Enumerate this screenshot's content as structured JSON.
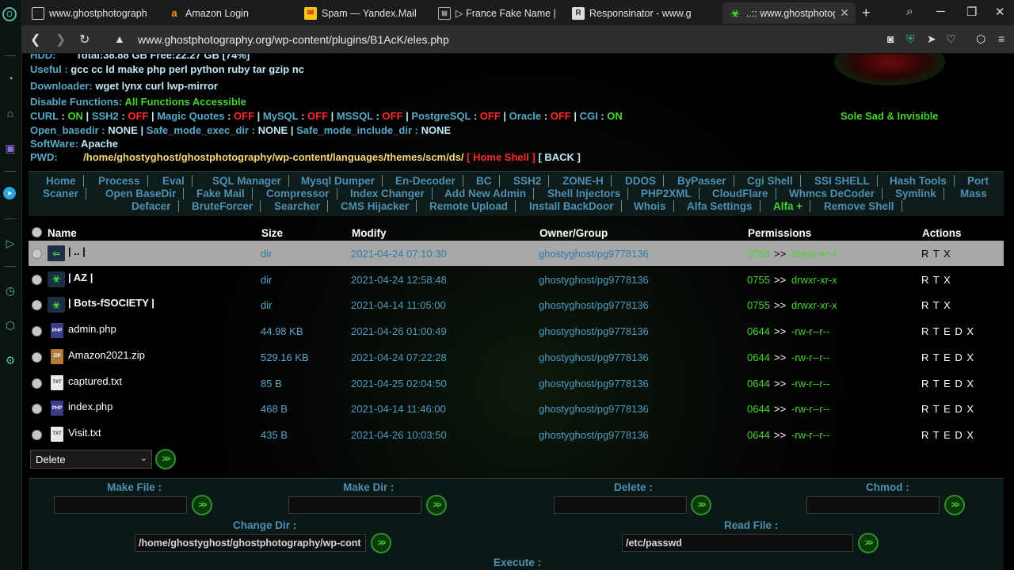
{
  "tabs": [
    {
      "title": "www.ghostphotograph",
      "favicon": "page-icon",
      "active": false
    },
    {
      "title": "Amazon Login",
      "favicon": "amazon-icon",
      "active": false
    },
    {
      "title": "Spam — Yandex.Mail",
      "favicon": "mail-icon",
      "active": false
    },
    {
      "title": "▷ France Fake Name | A",
      "favicon": "page-icon",
      "active": false
    },
    {
      "title": "Responsinator - www.g",
      "favicon": "r-icon",
      "active": false
    },
    {
      "title": "..:: www.ghostphotograp",
      "favicon": "biohazard-icon",
      "active": true
    }
  ],
  "address": {
    "url": "www.ghostphotography.org/wp-content/plugins/B1AcK/eles.php"
  },
  "info": {
    "hdd_label": "HDD:",
    "hdd_value": "Total:38.88 GB Free:22.27 GB [74%]",
    "useful_label": "Useful :",
    "useful_value": "gcc cc ld make php perl python ruby tar gzip nc",
    "downloader_label": "Downloader:",
    "downloader_value": "wget lynx curl lwp-mirror",
    "disable_label": "Disable Functions:",
    "disable_value": "All Functions Accessible",
    "flags": [
      {
        "name": "CURL",
        "value": "ON",
        "state": "g"
      },
      {
        "name": "SSH2",
        "value": "OFF",
        "state": "r"
      },
      {
        "name": "Magic Quotes",
        "value": "OFF",
        "state": "r"
      },
      {
        "name": "MySQL",
        "value": "OFF",
        "state": "r"
      },
      {
        "name": "MSSQL",
        "value": "OFF",
        "state": "r"
      },
      {
        "name": "PostgreSQL",
        "value": "OFF",
        "state": "r"
      },
      {
        "name": "Oracle",
        "value": "OFF",
        "state": "r"
      },
      {
        "name": "CGI",
        "value": "ON",
        "state": "g"
      }
    ],
    "open_basedir_label": "Open_basedir :",
    "open_basedir_value": "NONE",
    "safe_exec_label": "Safe_mode_exec_dir :",
    "safe_exec_value": "NONE",
    "safe_include_label": "Safe_mode_include_dir :",
    "safe_include_value": "NONE",
    "software_label": "SoftWare:",
    "software_value": "Apache",
    "pwd_label": "PWD:",
    "pwd_value": "/home/ghostyghost/ghostphotography/wp-content/languages/themes/scm/ds/",
    "home_shell": "[ Home Shell ]",
    "back": "[ BACK ]",
    "tagline": "Sole Sad & Invisible"
  },
  "menu": [
    "Home",
    "Process",
    "Eval",
    "SQL Manager",
    "Mysql Dumper",
    "En-Decoder",
    "BC",
    "SSH2",
    "ZONE-H",
    "DDOS",
    "ByPasser",
    "Cgi Shell",
    "SSI SHELL",
    "Hash Tools",
    "Port",
    "Scaner",
    "Open BaseDir",
    "Fake Mail",
    "Compressor",
    "Index Changer",
    "Add New Admin",
    "Shell Injectors",
    "PHP2XML",
    "CloudFlare",
    "Whmcs DeCoder",
    "Symlink",
    "Mass",
    "Defacer",
    "BruteForcer",
    "Searcher",
    "CMS Hijacker",
    "Remote Upload",
    "Install BackDoor",
    "Whois",
    "Alfa Settings",
    "Alfa +",
    "Remove Shell"
  ],
  "table": {
    "headers": [
      "Name",
      "Size",
      "Modify",
      "Owner/Group",
      "Permissions",
      "Actions"
    ],
    "rows": [
      {
        "icon": "up",
        "name": "| .. |",
        "size": "dir",
        "modified": "2021-04-24 07:10:30",
        "owner": "ghostyghost/pg9778136",
        "octal": "0755",
        "arrow": ">>",
        "perm": "drwxr-xr-x",
        "actions": "R T X"
      },
      {
        "icon": "folder",
        "name": "| AZ |",
        "size": "dir",
        "modified": "2021-04-24 12:58:48",
        "owner": "ghostyghost/pg9778136",
        "octal": "0755",
        "arrow": ">>",
        "perm": "drwxr-xr-x",
        "actions": "R T X"
      },
      {
        "icon": "folder",
        "name": "| Bots-fSOCIETY |",
        "size": "dir",
        "modified": "2021-04-14 11:05:00",
        "owner": "ghostyghost/pg9778136",
        "octal": "0755",
        "arrow": ">>",
        "perm": "drwxr-xr-x",
        "actions": "R T X"
      },
      {
        "icon": "php",
        "name": "admin.php",
        "size": "44.98 KB",
        "modified": "2021-04-26 01:00:49",
        "owner": "ghostyghost/pg9778136",
        "octal": "0644",
        "arrow": ">>",
        "perm": "-rw-r--r--",
        "actions": "R T E D X"
      },
      {
        "icon": "zip",
        "name": "Amazon2021.zip",
        "size": "529.16 KB",
        "modified": "2021-04-24 07:22:28",
        "owner": "ghostyghost/pg9778136",
        "octal": "0644",
        "arrow": ">>",
        "perm": "-rw-r--r--",
        "actions": "R T E D X"
      },
      {
        "icon": "txt",
        "name": "captured.txt",
        "size": "85 B",
        "modified": "2021-04-25 02:04:50",
        "owner": "ghostyghost/pg9778136",
        "octal": "0644",
        "arrow": ">>",
        "perm": "-rw-r--r--",
        "actions": "R T E D X"
      },
      {
        "icon": "php",
        "name": "index.php",
        "size": "468 B",
        "modified": "2021-04-14 11:46:00",
        "owner": "ghostyghost/pg9778136",
        "octal": "0644",
        "arrow": ">>",
        "perm": "-rw-r--r--",
        "actions": "R T E D X"
      },
      {
        "icon": "txt",
        "name": "Visit.txt",
        "size": "435 B",
        "modified": "2021-04-26 10:03:50",
        "owner": "ghostyghost/pg9778136",
        "octal": "0644",
        "arrow": ">>",
        "perm": "-rw-r--r--",
        "actions": "R T E D X"
      }
    ]
  },
  "bulk": {
    "selected": "Delete",
    "go": ">>"
  },
  "forms": {
    "make_file": "Make File :",
    "make_dir": "Make Dir :",
    "delete": "Delete :",
    "chmod": "Chmod :",
    "change_dir": "Change Dir :",
    "change_dir_value": "/home/ghostyghost/ghostphotography/wp-cont",
    "read_file": "Read File :",
    "read_file_value": "/etc/passwd",
    "execute": "Execute :"
  }
}
